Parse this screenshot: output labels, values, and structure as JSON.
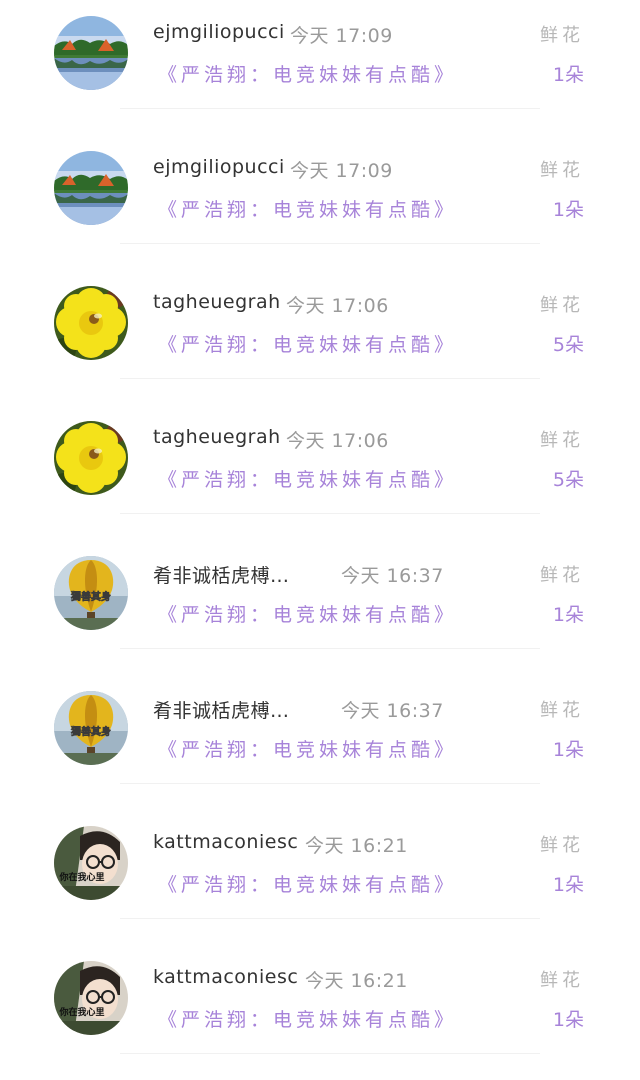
{
  "colors": {
    "accent_purple": "#a783d9",
    "username": "#333333",
    "time": "#9a9a9a",
    "label_gray": "#b7b7b7"
  },
  "gifts": [
    {
      "username": "ejmgiliopucci",
      "time": "今天 17:09",
      "message": "《严浩翔：电竞妹妹有点酷》",
      "label": "鲜花",
      "count": "1朵",
      "avatar": "lake-landscape-avatar"
    },
    {
      "username": "ejmgiliopucci",
      "time": "今天 17:09",
      "message": "《严浩翔：电竞妹妹有点酷》",
      "label": "鲜花",
      "count": "1朵",
      "avatar": "lake-landscape-avatar"
    },
    {
      "username": "tagheuegrah",
      "time": "今天 17:06",
      "message": "《严浩翔：电竞妹妹有点酷》",
      "label": "鲜花",
      "count": "5朵",
      "avatar": "yellow-flower-avatar"
    },
    {
      "username": "tagheuegrah",
      "time": "今天 17:06",
      "message": "《严浩翔：电竞妹妹有点酷》",
      "label": "鲜花",
      "count": "5朵",
      "avatar": "yellow-flower-avatar"
    },
    {
      "username": "肴非诚栝虎榑…",
      "time": "今天 16:37",
      "message": "《严浩翔：电竞妹妹有点酷》",
      "label": "鲜花",
      "count": "1朵",
      "avatar": "hot-air-balloon-avatar",
      "avatar_text": "獨善其身"
    },
    {
      "username": "肴非诚栝虎榑…",
      "time": "今天 16:37",
      "message": "《严浩翔：电竞妹妹有点酷》",
      "label": "鲜花",
      "count": "1朵",
      "avatar": "hot-air-balloon-avatar",
      "avatar_text": "獨善其身"
    },
    {
      "username": "kattmaconiesc",
      "time": "今天 16:21",
      "message": "《严浩翔：电竞妹妹有点酷》",
      "label": "鲜花",
      "count": "1朵",
      "avatar": "glasses-person-avatar",
      "avatar_text": "你在我心里"
    },
    {
      "username": "kattmaconiesc",
      "time": "今天 16:21",
      "message": "《严浩翔：电竞妹妹有点酷》",
      "label": "鲜花",
      "count": "1朵",
      "avatar": "glasses-person-avatar",
      "avatar_text": "你在我心里"
    }
  ]
}
